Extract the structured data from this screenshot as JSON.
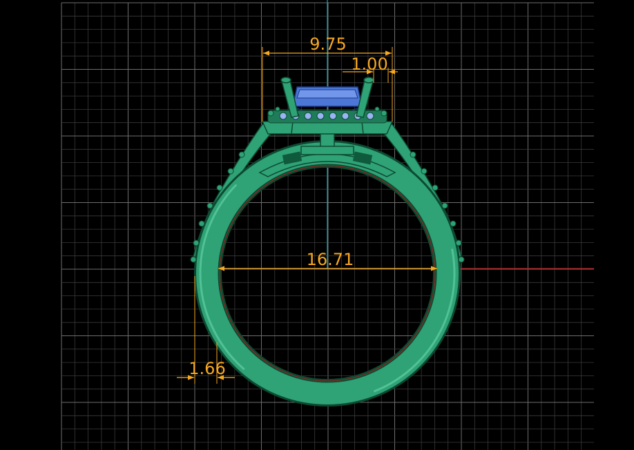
{
  "colors": {
    "background": "#000000",
    "grid_minor": "#3a3a3a",
    "grid_major": "#6e6e6e",
    "ring_body": "#2fa276",
    "ring_light": "#5fd0a2",
    "ring_dark": "#0c4a32",
    "gem": "#4c77d6",
    "gem_light": "#9ab3f5",
    "dimension": "#f6a821",
    "axis_vertical": "#1aa6b7",
    "axis_horizontal": "#b01818"
  },
  "dimensions": {
    "head_width": "9.75",
    "prong_width": "1.00",
    "inner_diameter": "16.71",
    "shank_thickness": "1.66"
  }
}
